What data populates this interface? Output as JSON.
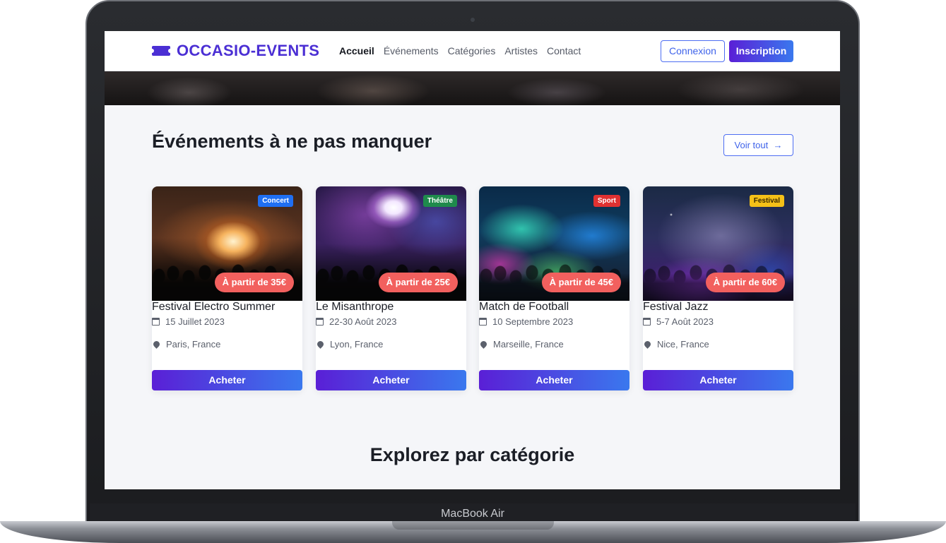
{
  "device": {
    "label": "MacBook Air"
  },
  "navbar": {
    "logo_text": "OCCASIO-EVENTS",
    "links": [
      "Accueil",
      "Événements",
      "Catégories",
      "Artistes",
      "Contact"
    ],
    "login_label": "Connexion",
    "signup_label": "Inscription"
  },
  "featured": {
    "title": "Événements à ne pas manquer",
    "see_all_label": "Voir tout",
    "cards": [
      {
        "tag": "Concert",
        "tag_color": "#1f6ff2",
        "price": "À partir de 35€",
        "title": "Festival Electro Summer",
        "date": "15 Juillet 2023",
        "location": "Paris, France",
        "buy_label": "Acheter"
      },
      {
        "tag": "Théâtre",
        "tag_color": "#1f8a4c",
        "price": "À partir de 25€",
        "title": "Le Misanthrope",
        "date": "22-30 Août 2023",
        "location": "Lyon, France",
        "buy_label": "Acheter"
      },
      {
        "tag": "Sport",
        "tag_color": "#e03131",
        "price": "À partir de 45€",
        "title": "Match de Football",
        "date": "10 Septembre 2023",
        "location": "Marseille, France",
        "buy_label": "Acheter"
      },
      {
        "tag": "Festival",
        "tag_color": "#f5c118",
        "price": "À partir de 60€",
        "title": "Festival Jazz",
        "date": "5-7 Août 2023",
        "location": "Nice, France",
        "buy_label": "Acheter"
      }
    ]
  },
  "categories": {
    "title": "Explorez par catégorie"
  },
  "colors": {
    "brand": "#4b2fd4",
    "accent": "#3f63ea",
    "price_badge": "#f2605e"
  }
}
